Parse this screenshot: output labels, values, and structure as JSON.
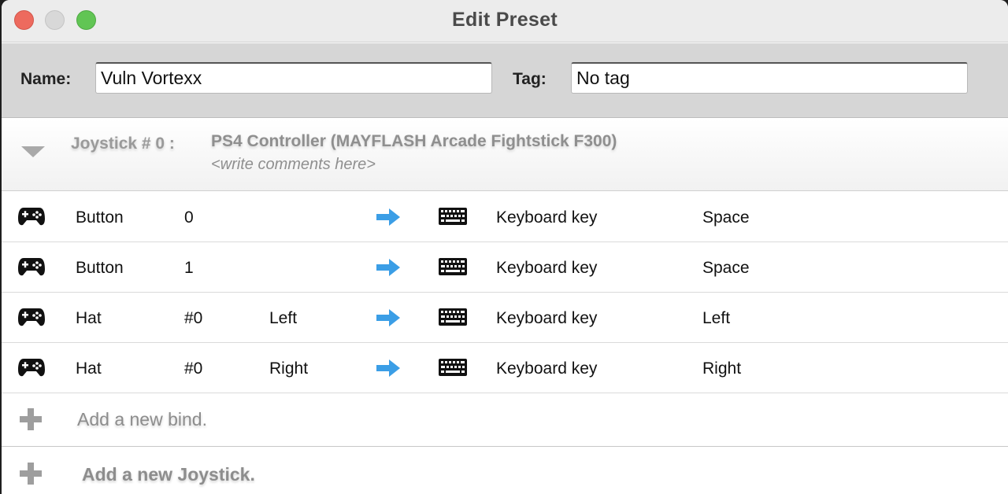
{
  "window": {
    "title": "Edit Preset"
  },
  "preset": {
    "name_label": "Name:",
    "name_value": "Vuln Vortexx",
    "tag_label": "Tag:",
    "tag_value": "No tag"
  },
  "joystick": {
    "label": "Joystick #  0 :",
    "device": "PS4 Controller (MAYFLASH Arcade Fightstick F300)",
    "comment": "<write comments here>"
  },
  "binds": [
    {
      "input_icon": "gamepad-icon",
      "input_type": "Button",
      "input_index": "0",
      "input_dir": "",
      "output_icon": "keyboard-icon",
      "output_type": "Keyboard key",
      "output_value": "Space"
    },
    {
      "input_icon": "gamepad-icon",
      "input_type": "Button",
      "input_index": "1",
      "input_dir": "",
      "output_icon": "keyboard-icon",
      "output_type": "Keyboard key",
      "output_value": "Space"
    },
    {
      "input_icon": "gamepad-icon",
      "input_type": "Hat",
      "input_index": "#0",
      "input_dir": "Left",
      "output_icon": "keyboard-icon",
      "output_type": "Keyboard key",
      "output_value": "Left"
    },
    {
      "input_icon": "gamepad-icon",
      "input_type": "Hat",
      "input_index": "#0",
      "input_dir": "Right",
      "output_icon": "keyboard-icon",
      "output_type": "Keyboard key",
      "output_value": "Right"
    }
  ],
  "actions": {
    "add_bind": "Add a new bind.",
    "add_joystick": "Add a new Joystick."
  },
  "colors": {
    "close": "#ed6a5e",
    "minimize": "#d8d8d8",
    "maximize": "#61c554",
    "arrow": "#3b9ee6"
  }
}
